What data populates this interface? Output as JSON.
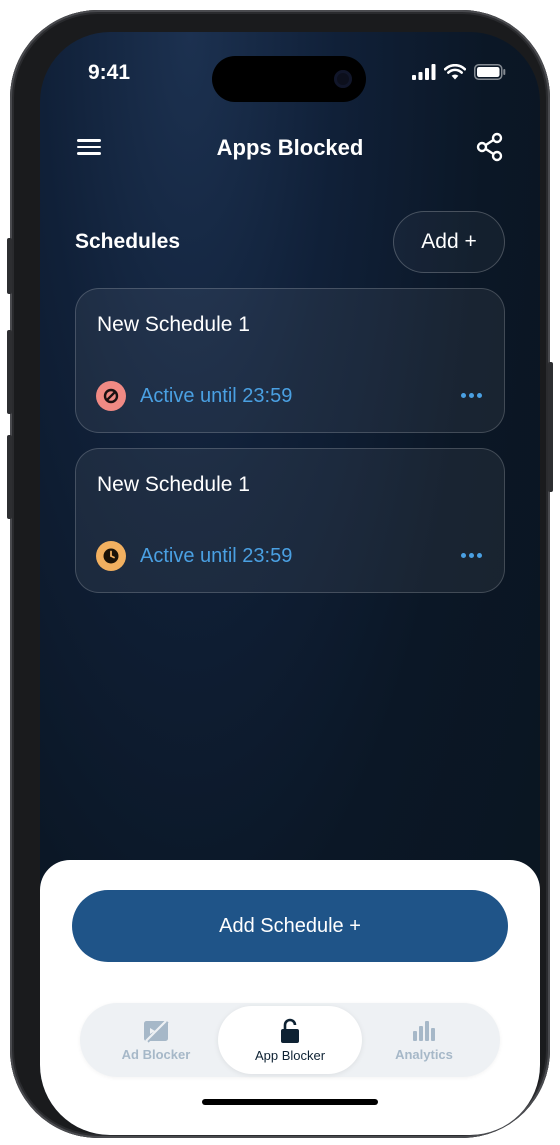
{
  "status_bar": {
    "time": "9:41"
  },
  "header": {
    "title": "Apps Blocked"
  },
  "schedules": {
    "section_title": "Schedules",
    "add_label": "Add +",
    "items": [
      {
        "title": "New Schedule 1",
        "status": "Active until 23:59",
        "icon": "block-icon",
        "icon_color": "#f08a84"
      },
      {
        "title": "New Schedule 1",
        "status": "Active until 23:59",
        "icon": "clock-icon",
        "icon_color": "#f2b060"
      }
    ]
  },
  "add_schedule_label": "Add Schedule +",
  "tabs": [
    {
      "label": "Ad Blocker",
      "icon": "ad-blocker-icon",
      "active": false
    },
    {
      "label": "App Blocker",
      "icon": "lock-open-icon",
      "active": true
    },
    {
      "label": "Analytics",
      "icon": "bar-chart-icon",
      "active": false
    }
  ],
  "colors": {
    "accent": "#4aa0e2",
    "primary_button": "#1f5488",
    "background": "#0b1726"
  }
}
